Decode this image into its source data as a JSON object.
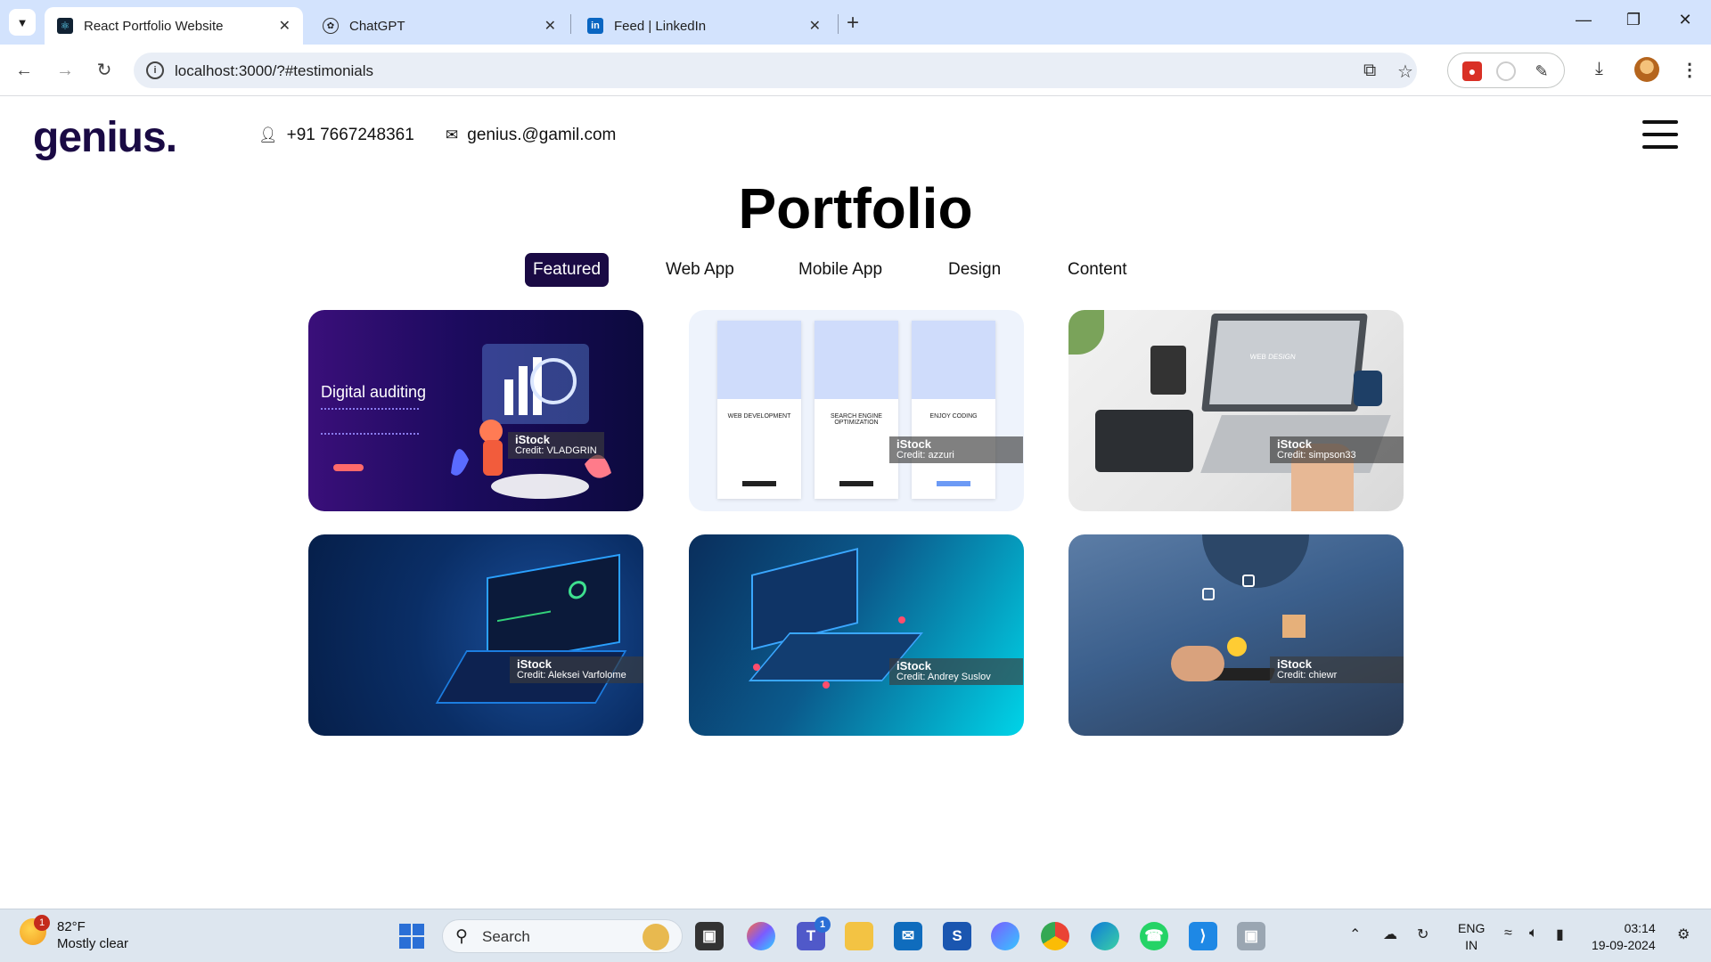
{
  "browser": {
    "tabs": [
      {
        "title": "React Portfolio Website",
        "active": true,
        "icon": "react-icon"
      },
      {
        "title": "ChatGPT",
        "active": false,
        "icon": "chatgpt-icon"
      },
      {
        "title": "Feed | LinkedIn",
        "active": false,
        "icon": "linkedin-icon"
      }
    ],
    "url": "localhost:3000/?#testimonials"
  },
  "header": {
    "logo": "genius.",
    "phone": "+91 7667248361",
    "email": "genius.@gamil.com"
  },
  "portfolio": {
    "title": "Portfolio",
    "filters": [
      "Featured",
      "Web App",
      "Mobile App",
      "Design",
      "Content"
    ],
    "active_filter": "Featured",
    "cards": [
      {
        "heading": "Digital auditing",
        "credit_brand": "iStock",
        "credit_text": "Credit: VLADGRIN"
      },
      {
        "columns": [
          "WEB DEVELOPMENT",
          "SEARCH ENGINE OPTIMIZATION",
          "ENJOY CODING"
        ],
        "credit_brand": "iStock",
        "credit_text": "Credit: azzuri"
      },
      {
        "screen_text": "WEB DESIGN",
        "credit_brand": "iStock",
        "credit_text": "Credit: simpson33"
      },
      {
        "credit_brand": "iStock",
        "credit_text": "Credit: Aleksei Varfolome"
      },
      {
        "credit_brand": "iStock",
        "credit_text": "Credit: Andrey Suslov"
      },
      {
        "credit_brand": "iStock",
        "credit_text": "Credit: chiewr"
      }
    ]
  },
  "taskbar": {
    "weather_temp": "82°F",
    "weather_desc": "Mostly clear",
    "weather_badge": "1",
    "search_placeholder": "Search",
    "teams_badge": "1",
    "lang_line1": "ENG",
    "lang_line2": "IN",
    "time": "03:14",
    "date": "19-09-2024"
  },
  "colors": {
    "brand": "#1a0a44",
    "tabstrip": "#d3e3fd",
    "taskbar": "#dde6ef"
  }
}
